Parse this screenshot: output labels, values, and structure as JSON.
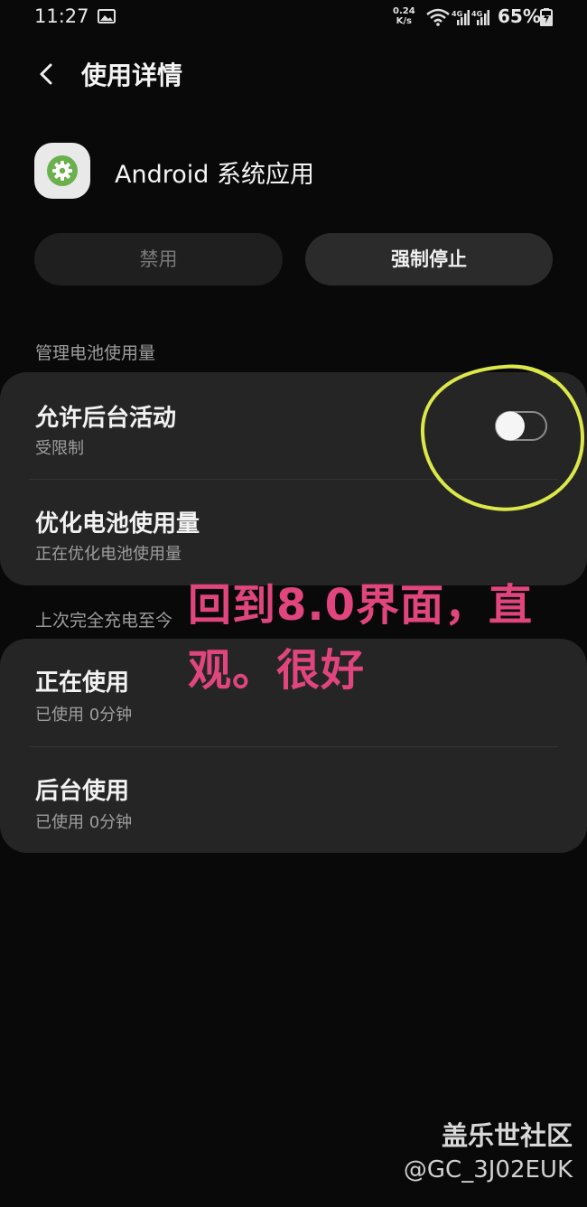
{
  "status_bar": {
    "time": "11:27",
    "net_speed_value": "0.24",
    "net_speed_unit": "K/s",
    "sim1_label": "4G",
    "sim2_label": "4G",
    "battery_pct": "65%"
  },
  "header": {
    "title": "使用详情"
  },
  "app": {
    "name": "Android 系统应用",
    "icon": "settings-gear-icon",
    "icon_color": "#6ab04c"
  },
  "buttons": {
    "disable": "禁用",
    "force_stop": "强制停止"
  },
  "battery_section": {
    "heading": "管理电池使用量",
    "allow_background": {
      "title": "允许后台活动",
      "subtitle": "受限制",
      "toggle_on": false
    },
    "optimize": {
      "title": "优化电池使用量",
      "subtitle": "正在优化电池使用量"
    }
  },
  "since_section": {
    "heading": "上次完全充电至今",
    "foreground": {
      "title": "正在使用",
      "subtitle": "已使用 0分钟"
    },
    "background": {
      "title": "后台使用",
      "subtitle": "已使用 0分钟"
    }
  },
  "overlay_annotation": {
    "line1": "回到8.0界面，直",
    "line2": "观。很好",
    "color": "#e0457d",
    "circle_color": "#dce84a"
  },
  "watermark": {
    "name": "盖乐世社区",
    "handle": "@GC_3J02EUK"
  }
}
